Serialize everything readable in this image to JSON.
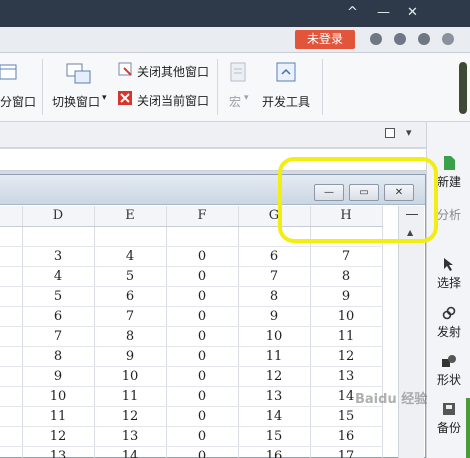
{
  "titlebar": {
    "controls": [
      "^",
      "—",
      "✕"
    ]
  },
  "account": {
    "login_label": "未登录"
  },
  "ribbon": {
    "partial_label": "分窗口",
    "switch_window": "切换窗口",
    "close_others": "关闭其他窗口",
    "close_current": "关闭当前窗口",
    "macro": "宏",
    "dev_tools": "开发工具"
  },
  "inner_window": {
    "min": "—",
    "restore": "▭",
    "close": "✕"
  },
  "grid": {
    "columns": [
      "D",
      "E",
      "F",
      "G",
      "H"
    ],
    "rows": [
      [
        "3",
        "4",
        "0",
        "6",
        "7"
      ],
      [
        "4",
        "5",
        "0",
        "7",
        "8"
      ],
      [
        "5",
        "6",
        "0",
        "8",
        "9"
      ],
      [
        "6",
        "7",
        "0",
        "9",
        "10"
      ],
      [
        "7",
        "8",
        "0",
        "10",
        "11"
      ],
      [
        "8",
        "9",
        "0",
        "11",
        "12"
      ],
      [
        "9",
        "10",
        "0",
        "12",
        "13"
      ],
      [
        "10",
        "11",
        "0",
        "13",
        "14"
      ],
      [
        "11",
        "12",
        "0",
        "14",
        "15"
      ],
      [
        "12",
        "13",
        "0",
        "15",
        "16"
      ],
      [
        "13",
        "14",
        "0",
        "16",
        "17"
      ]
    ]
  },
  "task_pane": {
    "new": "新建",
    "analyze": "分析",
    "select": "选择",
    "send": "发射",
    "shape": "形状",
    "backup": "备份"
  },
  "watermark": "Baidu 经验",
  "colors": {
    "highlight": "#f2ee12",
    "login": "#e2553b",
    "titlebar": "#2e3a4a"
  }
}
